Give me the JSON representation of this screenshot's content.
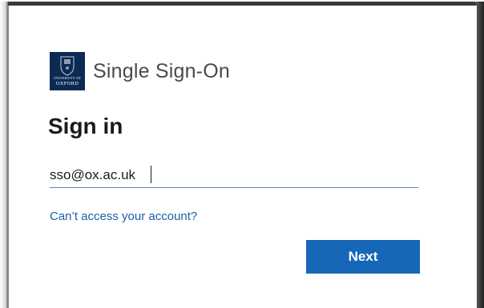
{
  "brand": {
    "logo_icon": "university-of-oxford-crest",
    "logo_text_small": "UNIVERSITY OF",
    "logo_text_big": "OXFORD",
    "title": "Single Sign-On"
  },
  "heading": "Sign in",
  "username_field": {
    "value": "sso@ox.ac.uk"
  },
  "help_link": "Can’t access your account?",
  "next_button": "Next",
  "colors": {
    "accent_blue": "#1667b8",
    "link_blue": "#1f5fa8",
    "oxford_navy": "#0c2a52"
  }
}
